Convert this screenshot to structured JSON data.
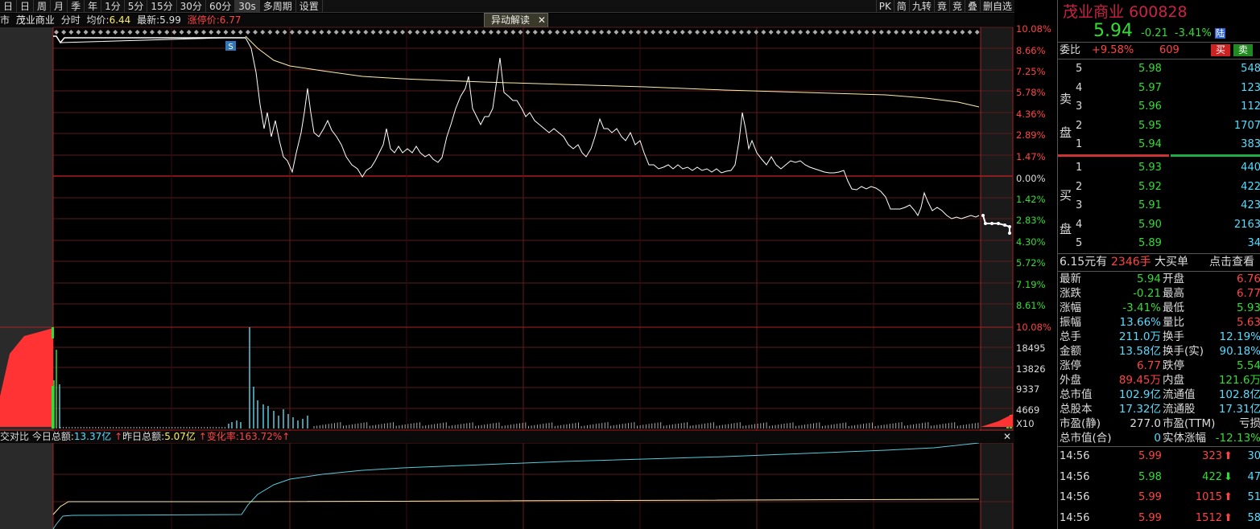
{
  "toolbar": {
    "items": [
      "日",
      "日",
      "周",
      "月",
      "季",
      "年",
      "1分",
      "5分",
      "15分",
      "30分",
      "60分",
      "30s",
      "多周期",
      "设置"
    ],
    "selected": "30s",
    "right_items": [
      "PK",
      "简",
      "九转",
      "竟",
      "竞",
      "叠",
      "删自选"
    ]
  },
  "info": {
    "market": "市",
    "name": "茂业商业",
    "mode": "分时",
    "avg_label": "均价:",
    "avg": "6.44",
    "last_label": "最新:",
    "last": "5.99",
    "limit_label": "涨停价:",
    "limit": "6.77"
  },
  "popup": {
    "label": "异动解读",
    "close": "✕"
  },
  "marker": {
    "label": "S"
  },
  "price_axis": [
    "10.08%",
    "8.66%",
    "7.25%",
    "5.78%",
    "4.36%",
    "2.89%",
    "1.47%",
    "0.00%",
    "1.42%",
    "2.83%",
    "4.30%",
    "5.72%",
    "7.19%",
    "8.61%"
  ],
  "vol_axis": [
    "10.08%",
    "18495",
    "13826",
    "9337",
    "4669",
    "X10"
  ],
  "bottom": {
    "prefix": "交对比",
    "today_label": "今日总额:",
    "today": "13.37亿",
    "yest_label": "昨日总额:",
    "yest": "5.07亿",
    "chg_label": "变化率:",
    "chg": "163.72%"
  },
  "stock": {
    "name": "茂业商业",
    "code": "600828",
    "price": "5.94",
    "chg": "-0.21",
    "pct": "-3.41%",
    "tag": "陆"
  },
  "weibi": {
    "label": "委比",
    "pct": "+9.58%",
    "diff": "609",
    "buy": "买",
    "sell": "卖"
  },
  "sell_label": [
    "卖",
    "盘"
  ],
  "buy_label": [
    "买",
    "盘"
  ],
  "asks": [
    {
      "lv": "5",
      "p": "5.98",
      "v": "548"
    },
    {
      "lv": "4",
      "p": "5.97",
      "v": "123"
    },
    {
      "lv": "3",
      "p": "5.96",
      "v": "112"
    },
    {
      "lv": "2",
      "p": "5.95",
      "v": "1707"
    },
    {
      "lv": "1",
      "p": "5.94",
      "v": "383"
    }
  ],
  "bids": [
    {
      "lv": "1",
      "p": "5.93",
      "v": "440"
    },
    {
      "lv": "2",
      "p": "5.92",
      "v": "422"
    },
    {
      "lv": "3",
      "p": "5.91",
      "v": "423"
    },
    {
      "lv": "4",
      "p": "5.90",
      "v": "2163"
    },
    {
      "lv": "5",
      "p": "5.89",
      "v": "34"
    }
  ],
  "bigorder": {
    "price": "6.15元有",
    "qty": "2346手",
    "label": "大买单",
    "link": "点击查看"
  },
  "stats": [
    {
      "l1": "最新",
      "v1": "5.94",
      "c1": "#33dd33",
      "l2": "开盘",
      "v2": "6.76",
      "c2": "#ff4444"
    },
    {
      "l1": "涨跌",
      "v1": "-0.21",
      "c1": "#33dd33",
      "l2": "最高",
      "v2": "6.77",
      "c2": "#ff4444"
    },
    {
      "l1": "涨幅",
      "v1": "-3.41%",
      "c1": "#33dd33",
      "l2": "最低",
      "v2": "5.93",
      "c2": "#33dd33"
    },
    {
      "l1": "振幅",
      "v1": "13.66%",
      "c1": "#55ddff",
      "l2": "量比",
      "v2": "5.63",
      "c2": "#ff4444"
    },
    {
      "l1": "总手",
      "v1": "211.0万",
      "c1": "#55ddff",
      "l2": "换手",
      "v2": "12.19%",
      "c2": "#55ddff"
    },
    {
      "l1": "金额",
      "v1": "13.58亿",
      "c1": "#55ddff",
      "l2": "换手(实)",
      "v2": "90.18%",
      "c2": "#55ddff"
    },
    {
      "l1": "涨停",
      "v1": "6.77",
      "c1": "#ff4444",
      "l2": "跌停",
      "v2": "5.54",
      "c2": "#33dd33"
    },
    {
      "l1": "外盘",
      "v1": "89.45万",
      "c1": "#ff4444",
      "l2": "内盘",
      "v2": "121.6万",
      "c2": "#33dd33"
    },
    {
      "l1": "总市值",
      "v1": "102.9亿",
      "c1": "#55ddff",
      "l2": "流通值",
      "v2": "102.8亿",
      "c2": "#55ddff"
    },
    {
      "l1": "总股本",
      "v1": "17.32亿",
      "c1": "#55ddff",
      "l2": "流通股",
      "v2": "17.31亿",
      "c2": "#55ddff"
    },
    {
      "l1": "市盈(静)",
      "v1": "277.0",
      "c1": "#dddddd",
      "l2": "市盈(TTM)",
      "v2": "亏损",
      "c2": "#dddddd"
    },
    {
      "l1": "总市值(合)",
      "v1": "0",
      "c1": "#55ddff",
      "l2": "实体涨幅",
      "v2": "-12.13%",
      "c2": "#33dd33"
    }
  ],
  "ticks": [
    {
      "t": "14:56",
      "p": "5.99",
      "v": "323",
      "dir": "up",
      "n": "30"
    },
    {
      "t": "14:56",
      "p": "5.98",
      "v": "422",
      "dir": "down",
      "n": "47"
    },
    {
      "t": "14:56",
      "p": "5.99",
      "v": "1015",
      "dir": "up",
      "n": "51"
    },
    {
      "t": "14:56",
      "p": "5.99",
      "v": "1512",
      "dir": "up",
      "n": "58"
    }
  ]
}
